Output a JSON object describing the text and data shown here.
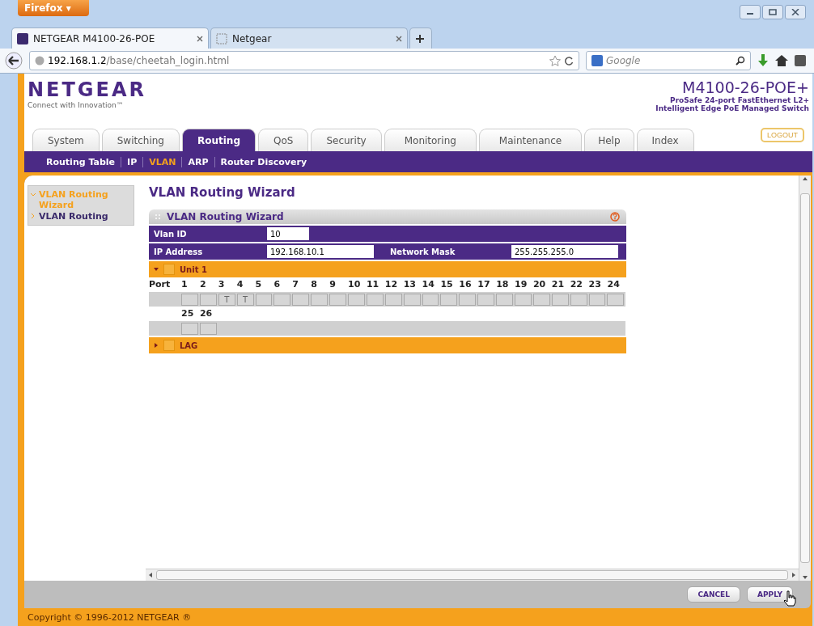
{
  "browser": {
    "menu_button": "Firefox ▾",
    "tabs": [
      {
        "title": "NETGEAR M4100-26-POE",
        "selected": true
      },
      {
        "title": "Netgear",
        "selected": false
      }
    ],
    "url_host": "192.168.1.2",
    "url_path": "/base/cheetah_login.html",
    "search_placeholder": "Google"
  },
  "header": {
    "logo": "NETGEAR",
    "tagline": "Connect with Innovation™",
    "model": "M4100-26-POE+",
    "description": [
      "ProSafe 24-port FastEthernet L2+",
      "Intelligent Edge PoE Managed Switch"
    ],
    "logout": "LOGOUT"
  },
  "main_tabs": [
    {
      "label": "System",
      "selected": false
    },
    {
      "label": "Switching",
      "selected": false
    },
    {
      "label": "Routing",
      "selected": true
    },
    {
      "label": "QoS",
      "selected": false
    },
    {
      "label": "Security",
      "selected": false
    },
    {
      "label": "Monitoring",
      "selected": false
    },
    {
      "label": "Maintenance",
      "selected": false
    },
    {
      "label": "Help",
      "selected": false
    },
    {
      "label": "Index",
      "selected": false
    }
  ],
  "sub_tabs": [
    {
      "label": "Routing Table",
      "selected": false
    },
    {
      "label": "IP",
      "selected": false
    },
    {
      "label": "VLAN",
      "selected": true
    },
    {
      "label": "ARP",
      "selected": false
    },
    {
      "label": "Router Discovery",
      "selected": false
    }
  ],
  "sidebar": {
    "items": [
      {
        "label": "VLAN Routing Wizard",
        "selected": true
      },
      {
        "label": "VLAN Routing",
        "selected": false
      }
    ]
  },
  "page_title": "VLAN Routing Wizard",
  "panel": {
    "title": "VLAN Routing Wizard",
    "vlan_id": {
      "label": "Vlan ID",
      "value": "10"
    },
    "ip_address": {
      "label": "IP Address",
      "value": "192.168.10.1"
    },
    "network_mask": {
      "label": "Network Mask",
      "value": "255.255.255.0"
    },
    "sections": [
      {
        "title": "Unit 1",
        "expanded": true,
        "port_header": "Port",
        "port_rows": [
          [
            {
              "label": "1"
            },
            {
              "label": "2"
            },
            {
              "label": "3",
              "mark": "T"
            },
            {
              "label": "4",
              "mark": "T"
            },
            {
              "label": "5"
            },
            {
              "label": "6"
            },
            {
              "label": "7"
            },
            {
              "label": "8"
            },
            {
              "label": "9"
            },
            {
              "label": "10"
            },
            {
              "label": "11"
            },
            {
              "label": "12"
            },
            {
              "label": "13"
            },
            {
              "label": "14"
            },
            {
              "label": "15"
            },
            {
              "label": "16"
            },
            {
              "label": "17"
            },
            {
              "label": "18"
            },
            {
              "label": "19"
            },
            {
              "label": "20"
            },
            {
              "label": "21"
            },
            {
              "label": "22"
            },
            {
              "label": "23"
            },
            {
              "label": "24"
            }
          ],
          [
            {
              "label": "25"
            },
            {
              "label": "26"
            }
          ]
        ]
      },
      {
        "title": "LAG",
        "expanded": false
      }
    ]
  },
  "buttons": [
    "CANCEL",
    "APPLY"
  ],
  "footer": "Copyright © 1996-2012 NETGEAR ®"
}
